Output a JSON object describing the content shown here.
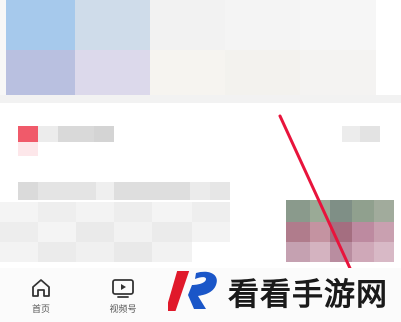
{
  "bottom_nav": {
    "items": [
      {
        "label": "首页",
        "icon": "home-icon"
      },
      {
        "label": "视频号",
        "icon": "video-channel-icon"
      }
    ]
  },
  "watermark": {
    "text": "看看手游网",
    "logo": "kk-logo",
    "logo_colors": {
      "red": "#e0192a",
      "blue": "#1a56c8"
    }
  },
  "annotation": {
    "arrow_color": "#e8143c"
  }
}
